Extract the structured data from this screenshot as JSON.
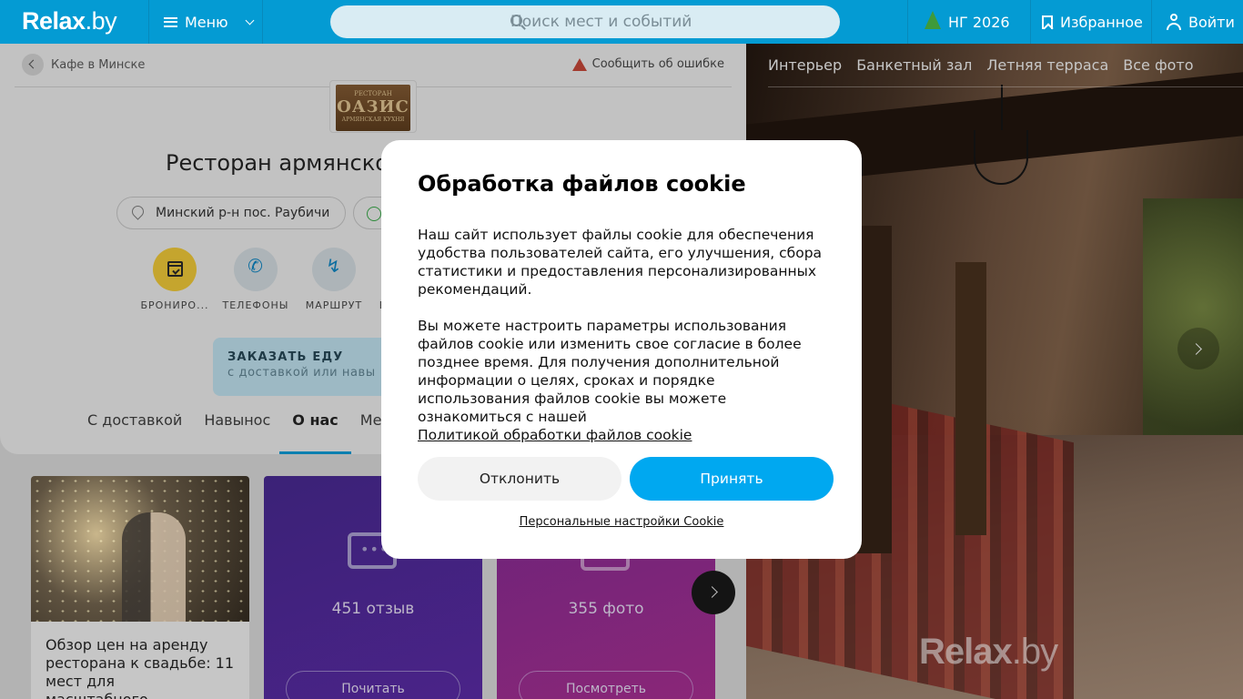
{
  "header": {
    "logo": "Relax",
    "logo_suffix": ".by",
    "menu_label": "Меню",
    "search_placeholder": "Поиск мест и событий",
    "ng_label": "НГ 2026",
    "favorites_label": "Избранное",
    "login_label": "Войти"
  },
  "breadcrumb": {
    "back_label": "Кафе в Минске",
    "report_label": "Сообщить об ошибке"
  },
  "venue": {
    "logo_lines": [
      "РЕСТОРАН",
      "ОАЗИС",
      "АРМЯНСКАЯ КУХНЯ"
    ],
    "title": "Ресторан армянско",
    "address": "Минский р-н пос. Раубичи"
  },
  "actions": [
    {
      "label": "БРОНИРО..."
    },
    {
      "label": "ТЕЛЕФОНЫ"
    },
    {
      "label": "МАРШРУТ"
    },
    {
      "label": "В"
    }
  ],
  "order_food": {
    "title": "ЗАКАЗАТЬ ЕДУ",
    "subtitle": "с доставкой или навы"
  },
  "tabs": [
    "С доставкой",
    "Навынос",
    "О нас",
    "Мен"
  ],
  "active_tab": "О нас",
  "cards": {
    "article": {
      "text": "Обзор цен на аренду ресторана к свадьбе: 11 мест для масштабного..."
    },
    "reviews": {
      "count_label": "451 отзыв",
      "button": "Почитать"
    },
    "photos": {
      "count_label": "355 фото",
      "button": "Посмотреть"
    }
  },
  "photo_panel": {
    "nav": [
      "Интерьер",
      "Банкетный зал",
      "Летняя терраса",
      "Все фото"
    ],
    "watermark": "Relax",
    "watermark_suffix": ".by"
  },
  "cookie_dialog": {
    "title": "Обработка файлов cookie",
    "p1": "Наш сайт использует файлы cookie для обеспечения удобства пользователей сайта, его улучшения, сбора статистики и предоставления персонализированных рекомендаций.",
    "p2": "Вы можете настроить параметры использования файлов cookie или изменить свое согласие в более позднее время. Для получения дополнительной информации о целях, сроках и порядке использования файлов cookie вы можете ознакомиться с нашей",
    "policy_link": "Политикой обработки файлов cookie",
    "decline": "Отклонить",
    "accept": "Принять",
    "settings_link": "Персональные настройки Cookie"
  },
  "colors": {
    "header": "#049bd3",
    "accept_button": "#00a8f0",
    "active_tab_underline": "#0a7fb0",
    "booking_circle": "#c5a52e"
  }
}
